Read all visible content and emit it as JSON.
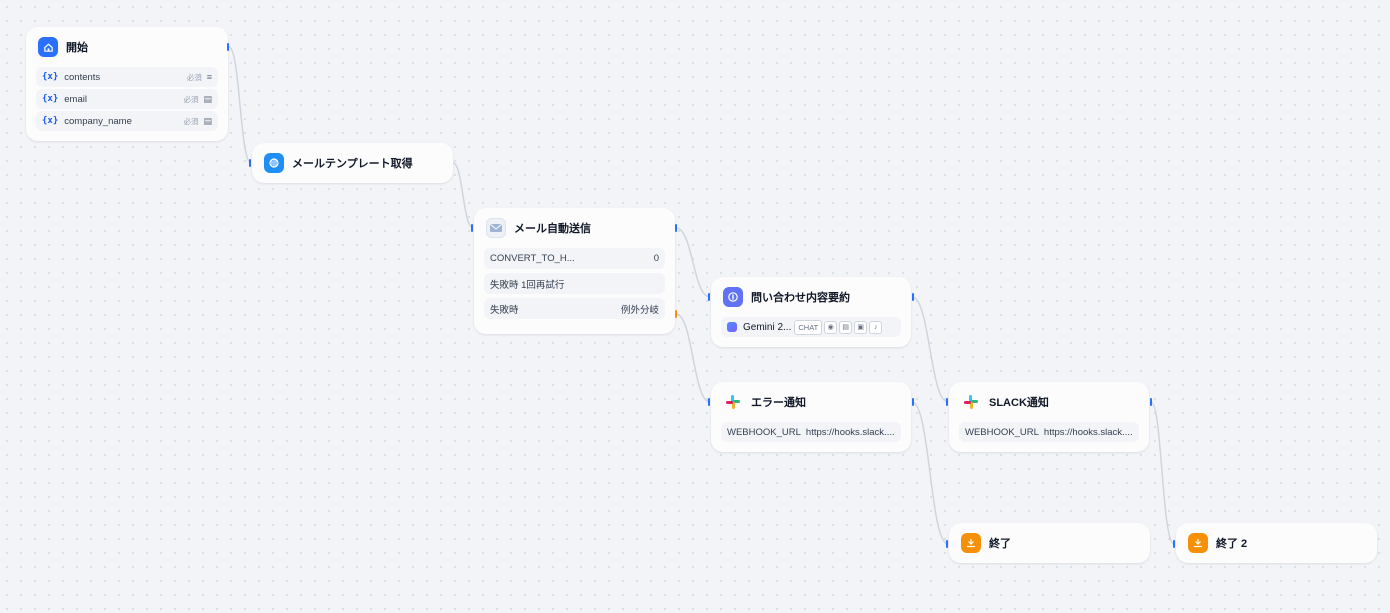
{
  "nodes": {
    "start": {
      "title": "開始",
      "vars": [
        {
          "prefix": "{x}",
          "name": "contents",
          "req": "必須",
          "type_icon": "≡"
        },
        {
          "prefix": "{x}",
          "name": "email",
          "req": "必須",
          "type_icon": "▤"
        },
        {
          "prefix": "{x}",
          "name": "company_name",
          "req": "必須",
          "type_icon": "▤"
        }
      ]
    },
    "template": {
      "title": "メールテンプレート取得"
    },
    "mail": {
      "title": "メール自動送信",
      "param_key": "CONVERT_TO_H...",
      "param_val": "0",
      "retry": "失敗時 1回再試行",
      "fail_label": "失敗時",
      "fail_val": "例外分岐"
    },
    "summary": {
      "title": "問い合わせ内容要約",
      "model": "Gemini 2...",
      "tag": "CHAT"
    },
    "error": {
      "title": "エラー通知",
      "key": "WEBHOOK_URL",
      "val": "https://hooks.slack...."
    },
    "slack": {
      "title": "SLACK通知",
      "key": "WEBHOOK_URL",
      "val": "https://hooks.slack...."
    },
    "end1": {
      "title": "終了"
    },
    "end2": {
      "title": "終了 2"
    }
  },
  "colors": {
    "accent": "#2970ff",
    "edge": "#d0d5dd",
    "fail_handle": "#f79009",
    "end_icon": "#f79009"
  }
}
